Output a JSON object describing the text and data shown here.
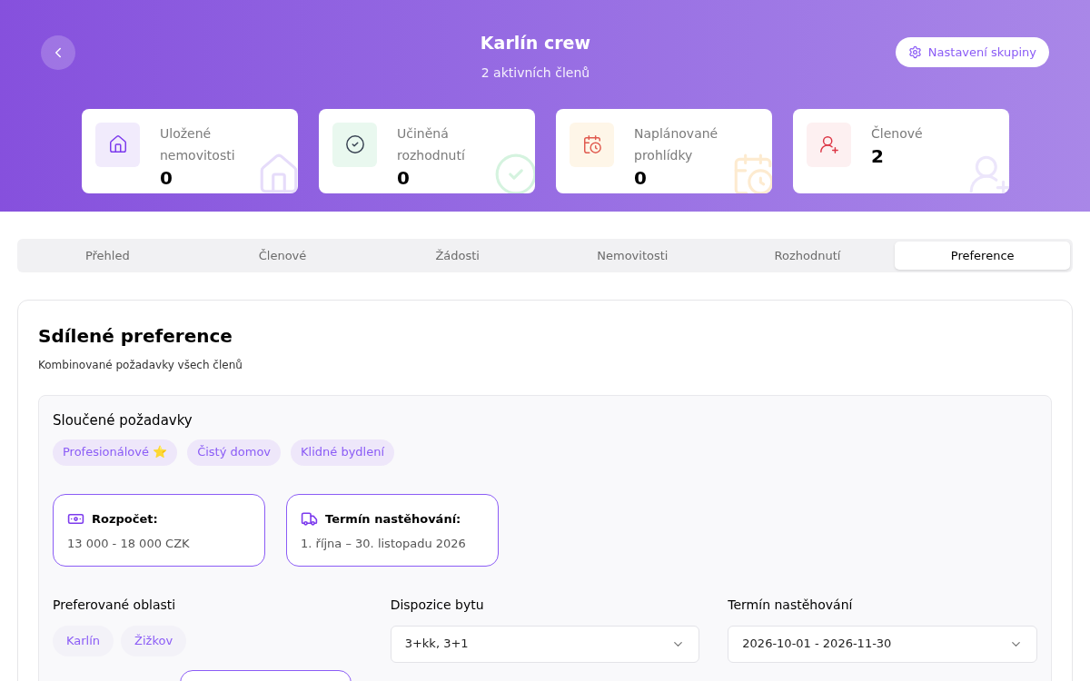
{
  "header": {
    "title": "Karlín crew",
    "subtitle": "2 aktivních členů",
    "settings_button": "Nastavení skupiny"
  },
  "stats": [
    {
      "kind": "home",
      "label": "Uložené nemovitosti",
      "value": "0"
    },
    {
      "kind": "check",
      "label": "Učiněná rozhodnutí",
      "value": "0"
    },
    {
      "kind": "calendar",
      "label": "Naplánované prohlídky",
      "value": "0"
    },
    {
      "kind": "user",
      "label": "Členové",
      "value": "2"
    }
  ],
  "tabs": [
    {
      "label": "Přehled",
      "selected": false
    },
    {
      "label": "Členové",
      "selected": false
    },
    {
      "label": "Žádosti",
      "selected": false
    },
    {
      "label": "Nemovitosti",
      "selected": false
    },
    {
      "label": "Rozhodnutí",
      "selected": false
    },
    {
      "label": "Preference",
      "selected": true
    }
  ],
  "section": {
    "title": "Sdílené preference",
    "subtitle": "Kombinované požadavky všech členů",
    "merged": {
      "title": "Sloučené požadavky",
      "tags": [
        "Profesionálové ⭐",
        "Čistý domov",
        "Klidné bydlení"
      ]
    },
    "info_cards": [
      {
        "kind": "money",
        "title": "Rozpočet:",
        "value": "13 000 - 18 000 CZK"
      },
      {
        "kind": "moving",
        "title": "Termín nastěhování:",
        "value": "1. října – 30. listopadu 2026"
      }
    ],
    "fields": [
      {
        "kind": "chips",
        "label": "Preferované oblasti",
        "chips": [
          "Karlín",
          "Žižkov"
        ]
      },
      {
        "kind": "select",
        "label": "Dispozice bytu",
        "value": "3+kk, 3+1"
      },
      {
        "kind": "select",
        "label": "Termín nastěhování",
        "value": "2026-10-01 - 2026-11-30"
      }
    ]
  }
}
